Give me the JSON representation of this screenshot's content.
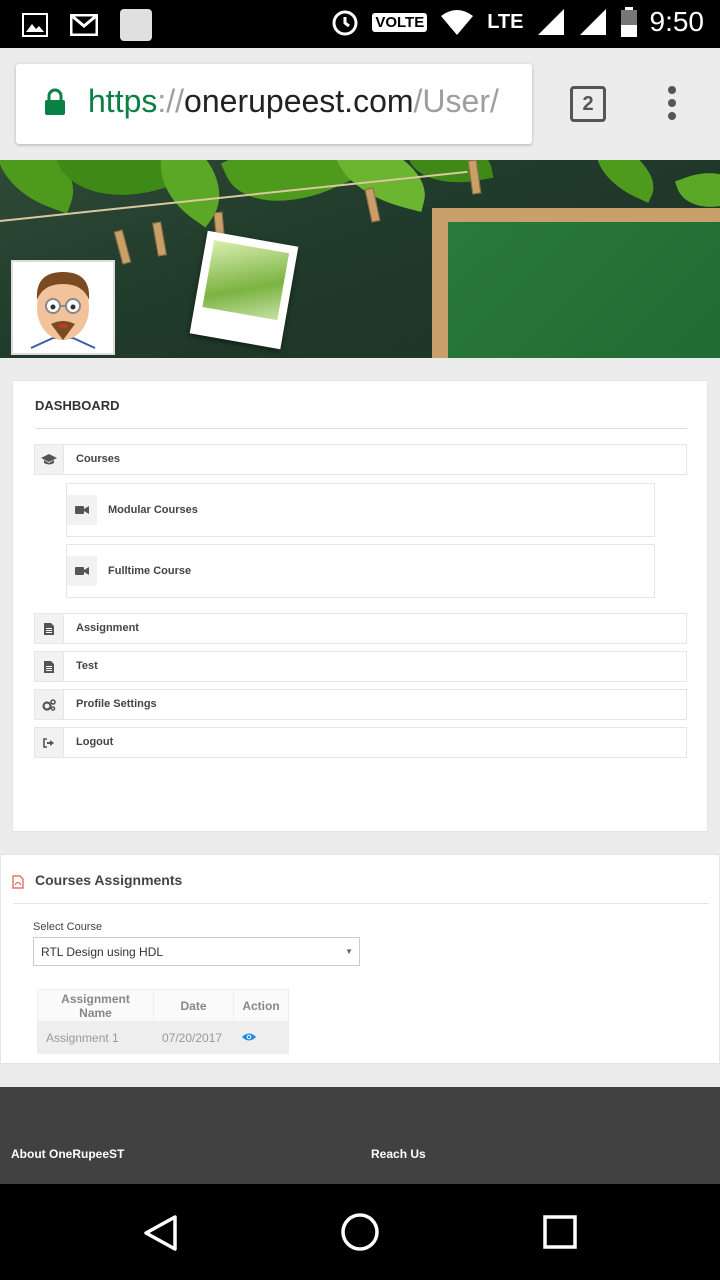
{
  "status_bar": {
    "time": "9:50",
    "network_badge": "VOLTE",
    "network_type": "LTE"
  },
  "browser": {
    "url_scheme": "https",
    "url_separator": "://",
    "url_host": "onerupeest.com",
    "url_path": "/User/",
    "tab_count": "2"
  },
  "dashboard": {
    "title": "DASHBOARD",
    "items": [
      {
        "label": "Courses",
        "icon": "graduation-cap-icon"
      },
      {
        "label": "Modular Courses",
        "icon": "video-camera-icon"
      },
      {
        "label": "Fulltime Course",
        "icon": "video-camera-icon"
      },
      {
        "label": "Assignment",
        "icon": "document-icon"
      },
      {
        "label": "Test",
        "icon": "document-icon"
      },
      {
        "label": "Profile Settings",
        "icon": "cogs-icon"
      },
      {
        "label": "Logout",
        "icon": "sign-out-icon"
      }
    ]
  },
  "assignments": {
    "title": "Courses Assignments",
    "select_label": "Select Course",
    "selected_course": "RTL Design using HDL",
    "columns": [
      "Assignment Name",
      "Date",
      "Action"
    ],
    "rows": [
      {
        "name": "Assignment 1",
        "date": "07/20/2017",
        "action_icon": "eye-icon"
      }
    ]
  },
  "footer": {
    "col1": "About OneRupeeST",
    "col2": "Reach Us"
  },
  "colors": {
    "accent_green": "#0b8043",
    "action_blue": "#1e88e5",
    "footer_bg": "#414141"
  }
}
